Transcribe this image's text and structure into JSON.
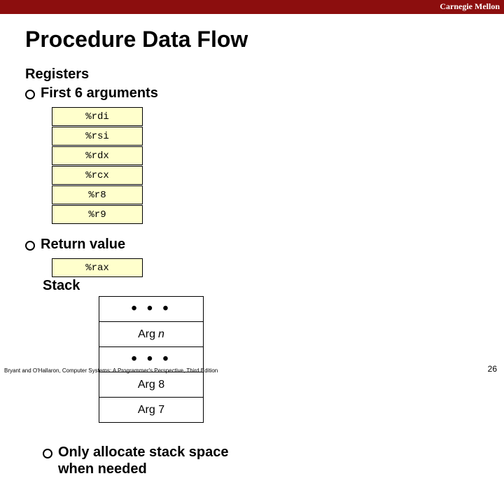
{
  "header": {
    "corner": "Carnegie Mellon"
  },
  "title": "Procedure Data Flow",
  "left": {
    "heading": "Registers",
    "bullet1": "First 6 arguments",
    "registers": [
      "%rdi",
      "%rsi",
      "%rdx",
      "%rcx",
      "%r8",
      "%r9"
    ],
    "bullet2": "Return value",
    "retreg": "%rax"
  },
  "right": {
    "heading": "Stack",
    "cells": {
      "dots1": "• • •",
      "argn_prefix": "Arg",
      "argn_suffix": "n",
      "dots2": "• • •",
      "arg8": "Arg 8",
      "arg7": "Arg 7"
    },
    "note": "Only allocate stack space when needed"
  },
  "footer": "Bryant and O'Hallaron, Computer Systems: A Programmer's Perspective, Third Edition",
  "pagenum": "26"
}
